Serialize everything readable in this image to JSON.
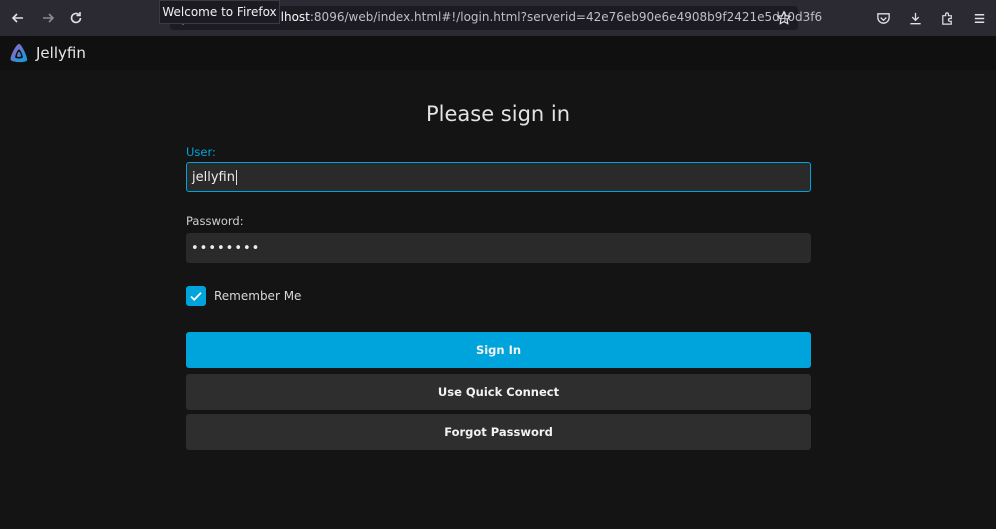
{
  "browser": {
    "tooltip": "Welcome to Firefox",
    "url_host": "localhost",
    "url_rest": ":8096/web/index.html#!/login.html?serverid=42e76eb90e6e4908b9f2421e5d40d3f6"
  },
  "app": {
    "name": "Jellyfin",
    "brand_color": "#00a4dc"
  },
  "login": {
    "title": "Please sign in",
    "user_label": "User:",
    "user_value": "jellyfin",
    "password_label": "Password:",
    "password_value": "••••••••",
    "remember_label": "Remember Me",
    "remember_checked": true,
    "sign_in_label": "Sign In",
    "quick_connect_label": "Use Quick Connect",
    "forgot_password_label": "Forgot Password"
  }
}
